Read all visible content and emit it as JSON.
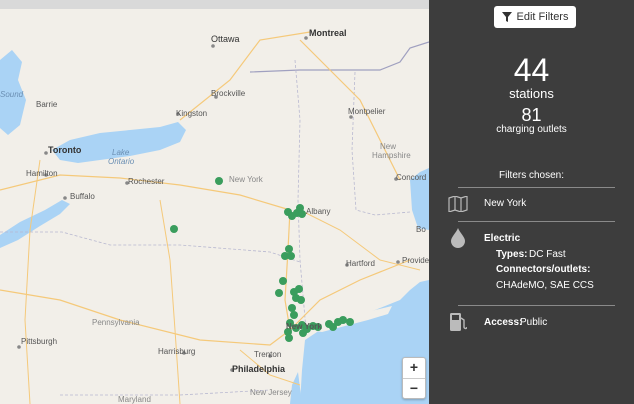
{
  "map": {
    "labels": {
      "ottawa": "Ottawa",
      "montreal": "Montreal",
      "brockville": "Brockville",
      "kingston": "Kingston",
      "montpelier": "Montpelier",
      "toronto": "Toronto",
      "lake_ontario_1": "Lake",
      "lake_ontario_2": "Ontario",
      "hamilton": "Hamilton",
      "rochester": "Rochester",
      "buffalo": "Buffalo",
      "new_york_state": "New York",
      "albany": "Albany",
      "new_hampshire_1": "New",
      "new_hampshire_2": "Hampshire",
      "concord": "Concord",
      "sound": "Sound",
      "barrie": "Barrie",
      "hartford": "Hartford",
      "providence": "Provide",
      "boston": "Bo",
      "pennsylvania": "Pennsylvania",
      "pittsburgh": "Pittsburgh",
      "harrisburg": "Harrisburg",
      "trenton": "Trenton",
      "new_york_city": "New York",
      "philadelphia": "Philadelphia",
      "maryland": "Maryland",
      "new_jersey": "New Jersey"
    },
    "station_color": "#3a9d5d",
    "zoom_in": "+",
    "zoom_out": "−"
  },
  "panel": {
    "edit_filters_label": "Edit Filters",
    "station_count": "44",
    "station_label": "stations",
    "outlet_count": "81",
    "outlet_label": "charging outlets",
    "filters_heading": "Filters chosen:",
    "location": "New York",
    "fuel_title": "Electric",
    "types_label": "Types:",
    "types_value": "DC Fast",
    "connectors_label": "Connectors/outlets:",
    "connectors_value": "CHAdeMO, SAE CCS",
    "access_label": "Access:",
    "access_value": "Public"
  },
  "colors": {
    "panel_bg": "#3d3d3d",
    "water": "#aad3f5",
    "land": "#f2efe9",
    "station": "#3a9d5d"
  }
}
